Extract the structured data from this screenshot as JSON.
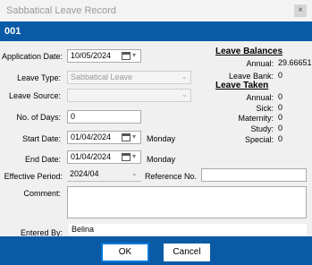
{
  "window": {
    "title": "Sabbatical Leave Record",
    "close_label": "×"
  },
  "header": {
    "record_code": "001"
  },
  "form": {
    "application_date_label": "Application Date:",
    "application_date": "10/05/2024",
    "leave_type_label": "Leave Type:",
    "leave_type": "Sabbatical Leave",
    "leave_source_label": "Leave Source:",
    "leave_source": "",
    "num_days_label": "No. of Days:",
    "num_days": "0",
    "start_date_label": "Start Date:",
    "start_date": "01/04/2024",
    "start_day": "Monday",
    "end_date_label": "End Date:",
    "end_date": "01/04/2024",
    "end_day": "Monday",
    "effective_period_label": "Effective Period:",
    "effective_period": "2024/04",
    "reference_no_label": "Reference No.",
    "reference_no": "",
    "comment_label": "Comment:",
    "comment": "",
    "entered_by_label": "Entered By:",
    "entered_by": "Belina"
  },
  "balances": {
    "title": "Leave Balances",
    "annual_label": "Annual:",
    "annual_value": "29.66651",
    "leave_bank_label": "Leave Bank:",
    "leave_bank_value": "0"
  },
  "taken": {
    "title": "Leave Taken",
    "annual_label": "Annual:",
    "annual_value": "0",
    "sick_label": "Sick:",
    "sick_value": "0",
    "maternity_label": "Maternity:",
    "maternity_value": "0",
    "study_label": "Study:",
    "study_value": "0",
    "special_label": "Special:",
    "special_value": "0"
  },
  "buttons": {
    "ok": "OK",
    "cancel": "Cancel"
  },
  "icons": {
    "calendar": "calendar-icon",
    "dropdown": "chevron-down-icon",
    "close": "close-icon"
  },
  "colors": {
    "accent": "#0a5aa6"
  }
}
